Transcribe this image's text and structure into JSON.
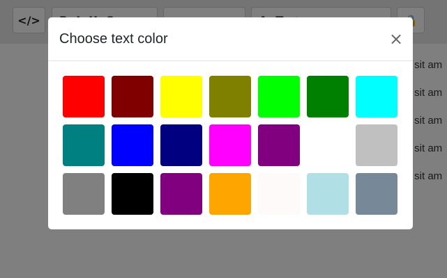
{
  "toolbar": {
    "code_icon_text": "</>",
    "g1": [
      "B",
      "I",
      "U",
      "S"
    ],
    "g2": [
      "≡",
      "≡",
      "≡"
    ],
    "g3": [
      "A",
      "T",
      "●",
      "▬"
    ],
    "g4": "🔒"
  },
  "content": {
    "lines": [
      "r sit am",
      "r sit am",
      "r sit am",
      "r sit am",
      "r sit am"
    ]
  },
  "modal": {
    "title": "Choose text color",
    "close_label": "×"
  },
  "colors": [
    "#ff0000",
    "#800000",
    "#ffff00",
    "#808000",
    "#00ff00",
    "#008000",
    "#00ffff",
    "#008080",
    "#0000ff",
    "#000080",
    "#ff00ff",
    "#800080",
    "#ffffff",
    "#c0c0c0",
    "#808080",
    "#000000",
    "#800080",
    "#ffa500",
    "#fffafa",
    "#b0e0e6",
    "#778899"
  ]
}
